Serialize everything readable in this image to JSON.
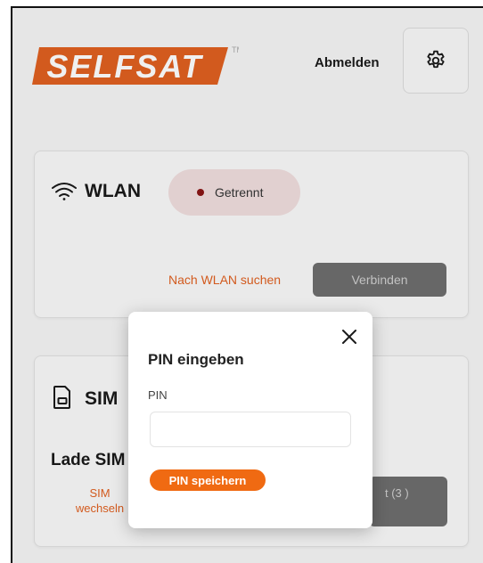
{
  "header": {
    "logo_text": "SELFSAT",
    "logo_tm": "TM",
    "logout_label": "Abmelden",
    "settings_icon": "gear-icon"
  },
  "wlan": {
    "title": "WLAN",
    "icon": "wifi-icon",
    "status": "Getrennt",
    "status_color": "#8a1616",
    "search_label": "Nach WLAN suchen",
    "connect_label": "Verbinden"
  },
  "sim": {
    "title": "SIM",
    "icon": "sim-card-icon",
    "loading_text": "Lade SIM",
    "switch_label": "SIM wechseln",
    "button_partial": "t (3 )"
  },
  "modal": {
    "title": "PIN eingeben",
    "pin_label": "PIN",
    "pin_value": "",
    "pin_placeholder": "",
    "save_label": "PIN speichern",
    "close_icon": "close-icon"
  },
  "colors": {
    "accent": "#f06a12",
    "link": "#e06020",
    "button_disabled": "#6e6e6e"
  }
}
